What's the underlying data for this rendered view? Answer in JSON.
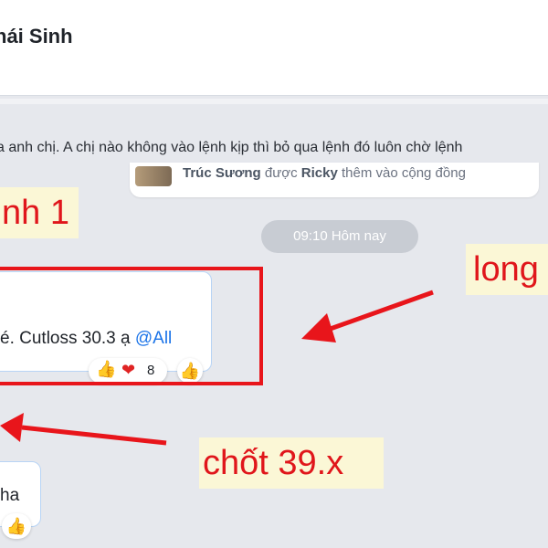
{
  "header": {
    "title": "hái Sinh"
  },
  "messages": {
    "top_line": "a anh chị. A chị nào không vào lệnh kịp thì bỏ qua lệnh đó luôn chờ lệnh",
    "system": {
      "actor": "Trúc Sương",
      "verb": "được",
      "inviter": "Ricky",
      "rest": "thêm vào cộng đồng"
    },
    "time_divider": "09:10 Hôm nay",
    "main": {
      "text": "é. Cutloss 30.3 ạ",
      "mention": "@All",
      "reaction_count": "8"
    },
    "small": {
      "text": "ha"
    }
  },
  "annotations": {
    "left": "nh 1",
    "right": "long",
    "bottom": "chốt 39.x"
  },
  "colors": {
    "annotation_red": "#e8151b",
    "label_bg": "#fbf7d6",
    "mention": "#1a73e8"
  },
  "icons": [
    "thumbs-up-icon",
    "heart-icon",
    "add-reaction-icon",
    "arrow-icon"
  ]
}
